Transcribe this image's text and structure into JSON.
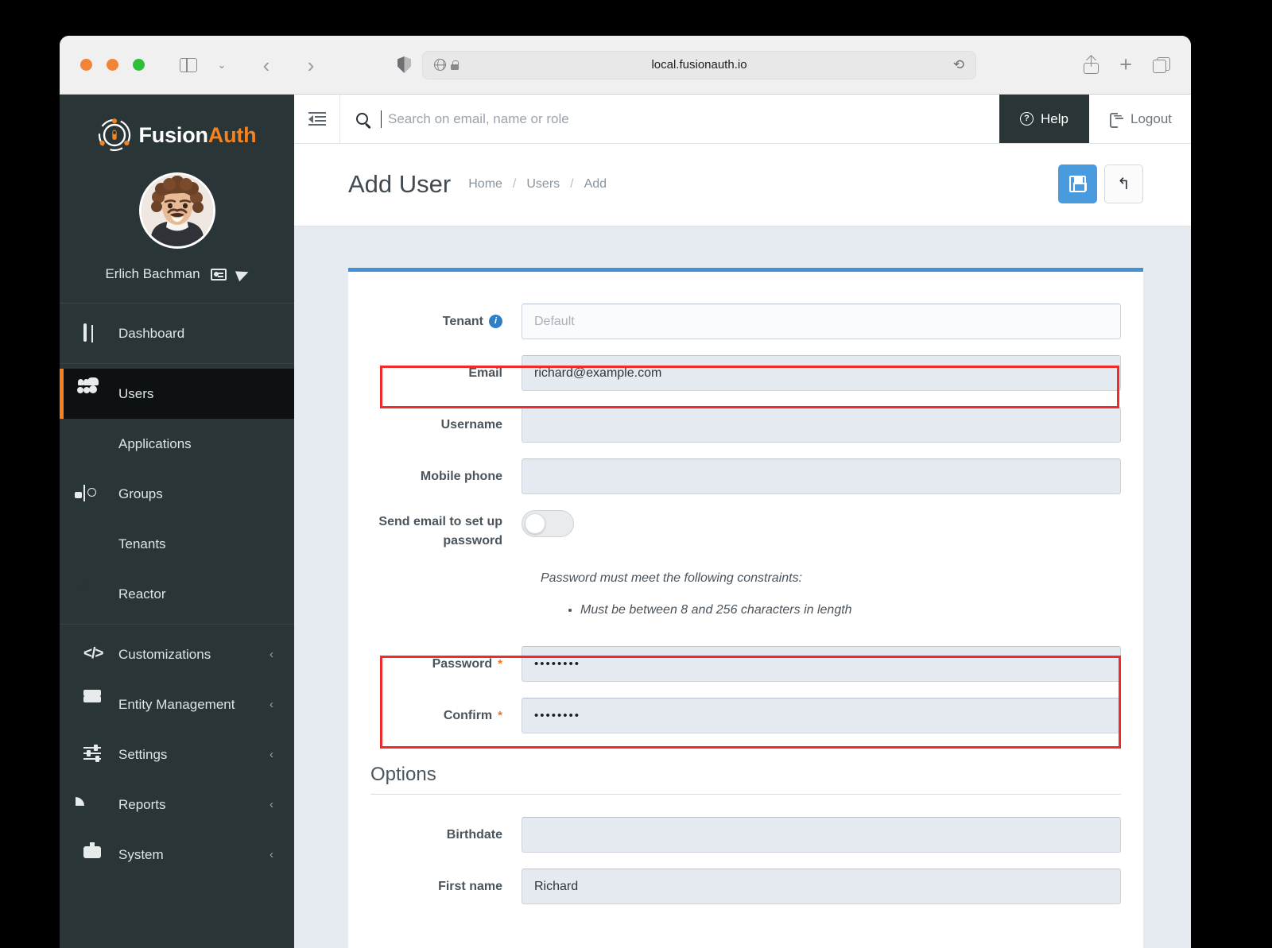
{
  "browser": {
    "url": "local.fusionauth.io",
    "traffic_lights": [
      "close",
      "minimize",
      "zoom"
    ],
    "back_label": "‹",
    "forward_label": "›",
    "sidebar_chevron": "⌄",
    "reload_label": "⟳"
  },
  "sidebar": {
    "brand": {
      "name_part1": "Fusion",
      "name_part2": "Auth"
    },
    "user": {
      "name": "Erlich Bachman"
    },
    "groups": [
      {
        "items": [
          {
            "label": "Dashboard",
            "icon": "dashboard-icon",
            "active": false,
            "expandable": false
          }
        ]
      },
      {
        "items": [
          {
            "label": "Users",
            "icon": "users-icon",
            "active": true,
            "expandable": false
          },
          {
            "label": "Applications",
            "icon": "applications-icon",
            "active": false,
            "expandable": false
          },
          {
            "label": "Groups",
            "icon": "groups-icon",
            "active": false,
            "expandable": false
          },
          {
            "label": "Tenants",
            "icon": "tenants-icon",
            "active": false,
            "expandable": false
          },
          {
            "label": "Reactor",
            "icon": "reactor-icon",
            "active": false,
            "expandable": false
          }
        ]
      },
      {
        "items": [
          {
            "label": "Customizations",
            "icon": "code-icon",
            "active": false,
            "expandable": true
          },
          {
            "label": "Entity Management",
            "icon": "server-icon",
            "active": false,
            "expandable": true
          },
          {
            "label": "Settings",
            "icon": "settings-icon",
            "active": false,
            "expandable": true
          },
          {
            "label": "Reports",
            "icon": "pie-chart-icon",
            "active": false,
            "expandable": true
          },
          {
            "label": "System",
            "icon": "monitor-icon",
            "active": false,
            "expandable": true
          }
        ]
      }
    ],
    "caret": "‹"
  },
  "topbar": {
    "search_placeholder": "Search on email, name or role",
    "search_value": "",
    "help_label": "Help",
    "logout_label": "Logout",
    "help_icon_glyph": "?"
  },
  "page": {
    "title": "Add User",
    "breadcrumbs": [
      "Home",
      "Users",
      "Add"
    ],
    "breadcrumb_separator": "/",
    "actions": [
      {
        "name": "save-button",
        "icon": "floppy-disk-icon"
      },
      {
        "name": "back-button",
        "icon": "undo-arrow-icon",
        "glyph": "↰"
      }
    ]
  },
  "form": {
    "fields": [
      {
        "label": "Tenant",
        "value": "Default",
        "is_placeholder": true,
        "info": true,
        "required": false
      },
      {
        "label": "Email",
        "value": "richard@example.com",
        "is_placeholder": false,
        "info": false,
        "required": false
      },
      {
        "label": "Username",
        "value": "",
        "is_placeholder": false,
        "info": false,
        "required": false
      },
      {
        "label": "Mobile phone",
        "value": "",
        "is_placeholder": false,
        "info": false,
        "required": false
      }
    ],
    "toggle": {
      "label": "Send email to set up password",
      "checked": false
    },
    "constraints": {
      "intro": "Password must meet the following constraints:",
      "items": [
        "Must be between 8 and 256 characters in length"
      ]
    },
    "password_fields": [
      {
        "label": "Password",
        "value": "••••••••",
        "required": true
      },
      {
        "label": "Confirm",
        "value": "••••••••",
        "required": true
      }
    ],
    "options_section": {
      "title": "Options",
      "fields": [
        {
          "label": "Birthdate",
          "value": ""
        },
        {
          "label": "First name",
          "value": "Richard"
        }
      ]
    },
    "required_marker": "*",
    "info_glyph": "i"
  },
  "annotations": {
    "highlight_color": "#ef2b2b",
    "boxes": [
      "email-field",
      "password-fields"
    ]
  },
  "colors": {
    "sidebar_bg": "#2a3538",
    "sidebar_active_bg": "#0e1113",
    "accent_orange": "#f58220",
    "accent_blue": "#4190d8",
    "content_bg": "#e6eaf1",
    "field_bg": "#e5eaf1"
  }
}
